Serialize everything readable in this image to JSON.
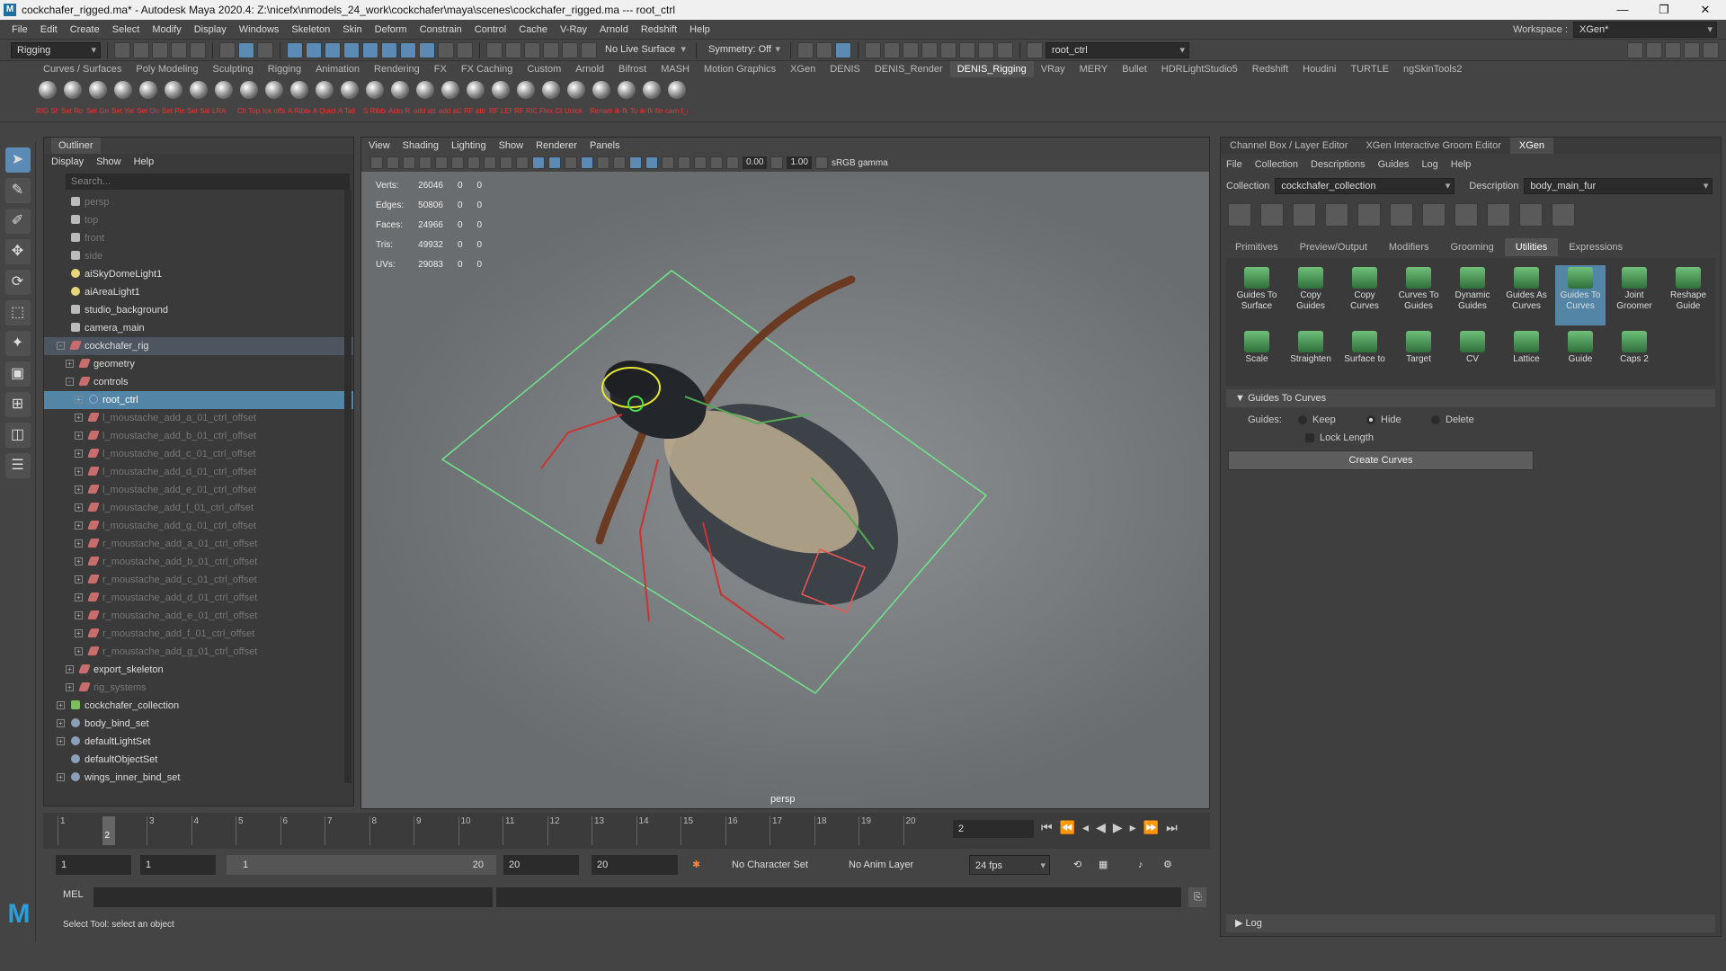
{
  "titlebar": {
    "title": "cockchafer_rigged.ma* - Autodesk Maya 2020.4: Z:\\nicefx\\nmodels_24_work\\cockchafer\\maya\\scenes\\cockchafer_rigged.ma   ---   root_ctrl",
    "logo": "M",
    "min": "—",
    "max": "❐",
    "close": "✕"
  },
  "menubar": {
    "items": [
      "File",
      "Edit",
      "Create",
      "Select",
      "Modify",
      "Display",
      "Windows",
      "Skeleton",
      "Skin",
      "Deform",
      "Constrain",
      "Control",
      "Cache",
      "V-Ray",
      "Arnold",
      "Redshift",
      "Help"
    ],
    "workspace_label": "Workspace :",
    "workspace_value": "XGen*"
  },
  "statusline": {
    "menuset": "Rigging",
    "live_surface": "No Live Surface",
    "symmetry": "Symmetry: Off",
    "selection_field": "root_ctrl"
  },
  "shelf": {
    "tabs": [
      "Curves / Surfaces",
      "Poly Modeling",
      "Sculpting",
      "Rigging",
      "Animation",
      "Rendering",
      "FX",
      "FX Caching",
      "Custom",
      "Arnold",
      "Bifrost",
      "MASH",
      "Motion Graphics",
      "XGen",
      "DENIS",
      "DENIS_Render",
      "DENIS_Rigging",
      "VRay",
      "MERY",
      "Bullet",
      "HDRLightStudio5",
      "Redshift",
      "Houdini",
      "TURTLE",
      "ngSkinTools2"
    ],
    "active_tab": "DENIS_Rigging",
    "buttons": [
      "RIG Sha",
      "Set Rot",
      "Set Gre",
      "Set Yell",
      "Set Ora",
      "Set Pink",
      "Set Sala",
      "LRA",
      "Ch Topo",
      "Ick offs",
      "A Ribbo",
      "A Quick",
      "A Tail",
      "S Ribbo",
      "Auto RIG",
      "add att",
      "add at2",
      "RF attr",
      "RF LEFT",
      "RF RIGH",
      "Flex Ctr",
      "Unlck",
      "Renam",
      "ik-fk To",
      "ik-fk fin",
      "cam f_ri"
    ]
  },
  "outliner": {
    "tab": "Outliner",
    "menu": [
      "Display",
      "Show",
      "Help"
    ],
    "search_placeholder": "Search...",
    "rows": [
      {
        "label": "persp",
        "icon": "cam",
        "indent": 0,
        "dim": true
      },
      {
        "label": "top",
        "icon": "cam",
        "indent": 0,
        "dim": true
      },
      {
        "label": "front",
        "icon": "cam",
        "indent": 0,
        "dim": true
      },
      {
        "label": "side",
        "icon": "cam",
        "indent": 0,
        "dim": true
      },
      {
        "label": "aiSkyDomeLight1",
        "icon": "light",
        "indent": 0
      },
      {
        "label": "aiAreaLight1",
        "icon": "light",
        "indent": 0
      },
      {
        "label": "studio_background",
        "icon": "cam",
        "indent": 0
      },
      {
        "label": "camera_main",
        "icon": "cam",
        "indent": 0
      },
      {
        "label": "cockchafer_rig",
        "icon": "grp",
        "indent": 0,
        "pm": "-",
        "hl": true
      },
      {
        "label": "geometry",
        "icon": "grp",
        "indent": 1,
        "pm": "+"
      },
      {
        "label": "controls",
        "icon": "grp",
        "indent": 1,
        "pm": "-"
      },
      {
        "label": "root_ctrl",
        "icon": "crv",
        "indent": 2,
        "pm": "+",
        "sel": true
      },
      {
        "label": "l_moustache_add_a_01_ctrl_offset",
        "icon": "grp",
        "indent": 2,
        "pm": "+",
        "dim": true
      },
      {
        "label": "l_moustache_add_b_01_ctrl_offset",
        "icon": "grp",
        "indent": 2,
        "pm": "+",
        "dim": true
      },
      {
        "label": "l_moustache_add_c_01_ctrl_offset",
        "icon": "grp",
        "indent": 2,
        "pm": "+",
        "dim": true
      },
      {
        "label": "l_moustache_add_d_01_ctrl_offset",
        "icon": "grp",
        "indent": 2,
        "pm": "+",
        "dim": true
      },
      {
        "label": "l_moustache_add_e_01_ctrl_offset",
        "icon": "grp",
        "indent": 2,
        "pm": "+",
        "dim": true
      },
      {
        "label": "l_moustache_add_f_01_ctrl_offset",
        "icon": "grp",
        "indent": 2,
        "pm": "+",
        "dim": true
      },
      {
        "label": "l_moustache_add_g_01_ctrl_offset",
        "icon": "grp",
        "indent": 2,
        "pm": "+",
        "dim": true
      },
      {
        "label": "r_moustache_add_a_01_ctrl_offset",
        "icon": "grp",
        "indent": 2,
        "pm": "+",
        "dim": true
      },
      {
        "label": "r_moustache_add_b_01_ctrl_offset",
        "icon": "grp",
        "indent": 2,
        "pm": "+",
        "dim": true
      },
      {
        "label": "r_moustache_add_c_01_ctrl_offset",
        "icon": "grp",
        "indent": 2,
        "pm": "+",
        "dim": true
      },
      {
        "label": "r_moustache_add_d_01_ctrl_offset",
        "icon": "grp",
        "indent": 2,
        "pm": "+",
        "dim": true
      },
      {
        "label": "r_moustache_add_e_01_ctrl_offset",
        "icon": "grp",
        "indent": 2,
        "pm": "+",
        "dim": true
      },
      {
        "label": "r_moustache_add_f_01_ctrl_offset",
        "icon": "grp",
        "indent": 2,
        "pm": "+",
        "dim": true
      },
      {
        "label": "r_moustache_add_g_01_ctrl_offset",
        "icon": "grp",
        "indent": 2,
        "pm": "+",
        "dim": true
      },
      {
        "label": "export_skeleton",
        "icon": "grp",
        "indent": 1,
        "pm": "+"
      },
      {
        "label": "rig_systems",
        "icon": "grp",
        "indent": 1,
        "pm": "+",
        "dim": true
      },
      {
        "label": "cockchafer_collection",
        "icon": "coll",
        "indent": 0,
        "pm": "+"
      },
      {
        "label": "body_bind_set",
        "icon": "set",
        "indent": 0,
        "pm": "+"
      },
      {
        "label": "defaultLightSet",
        "icon": "set",
        "indent": 0,
        "pm": "+"
      },
      {
        "label": "defaultObjectSet",
        "icon": "set",
        "indent": 0
      },
      {
        "label": "wings_inner_bind_set",
        "icon": "set",
        "indent": 0,
        "pm": "+"
      }
    ]
  },
  "viewport": {
    "menu": [
      "View",
      "Shading",
      "Lighting",
      "Show",
      "Renderer",
      "Panels"
    ],
    "val1": "0.00",
    "val2": "1.00",
    "colorspace": "sRGB gamma",
    "camera": "persp",
    "hud": [
      {
        "label": "Verts:",
        "v": "26046",
        "a": "0",
        "b": "0"
      },
      {
        "label": "Edges:",
        "v": "50806",
        "a": "0",
        "b": "0"
      },
      {
        "label": "Faces:",
        "v": "24966",
        "a": "0",
        "b": "0"
      },
      {
        "label": "Tris:",
        "v": "49932",
        "a": "0",
        "b": "0"
      },
      {
        "label": "UVs:",
        "v": "29083",
        "a": "0",
        "b": "0"
      }
    ]
  },
  "right": {
    "tabs": [
      "Channel Box / Layer Editor",
      "XGen Interactive Groom Editor",
      "XGen"
    ],
    "active_tab": "XGen",
    "menu": [
      "File",
      "Collection",
      "Descriptions",
      "Guides",
      "Log",
      "Help"
    ],
    "collection_label": "Collection",
    "collection_value": "cockchafer_collection",
    "description_label": "Description",
    "description_value": "body_main_fur",
    "xtabs": [
      "Primitives",
      "Preview/Output",
      "Modifiers",
      "Grooming",
      "Utilities",
      "Expressions"
    ],
    "active_xtab": "Utilities",
    "utilities": [
      "Guides To Surface",
      "Copy Guides",
      "Copy Curves",
      "Curves To Guides",
      "Dynamic Guides",
      "Guides As Curves",
      "Guides To Curves",
      "Joint Groomer",
      "Reshape Guide",
      "Scale",
      "Straighten",
      "Surface to",
      "Target",
      "CV",
      "Lattice",
      "Guide",
      "Caps 2"
    ],
    "active_utility": "Guides To Curves",
    "section": "Guides To Curves",
    "guides_label": "Guides:",
    "opt_keep": "Keep",
    "opt_hide": "Hide",
    "opt_delete": "Delete",
    "lock_length": "Lock Length",
    "create_curves": "Create Curves",
    "log": "Log"
  },
  "timeline": {
    "ticks": [
      "1",
      "2",
      "3",
      "4",
      "5",
      "6",
      "7",
      "8",
      "9",
      "10",
      "11",
      "12",
      "13",
      "14",
      "15",
      "16",
      "17",
      "18",
      "19",
      "20"
    ],
    "current_marker": "2",
    "current_frame": "2"
  },
  "range": {
    "start": "1",
    "start2": "1",
    "slider_start": "1",
    "slider_end": "20",
    "end": "20",
    "end2": "20",
    "character_set": "No Character Set",
    "anim_layer": "No Anim Layer",
    "fps": "24 fps"
  },
  "cmdline": {
    "label": "MEL"
  },
  "help": {
    "text": "Select Tool: select an object"
  }
}
